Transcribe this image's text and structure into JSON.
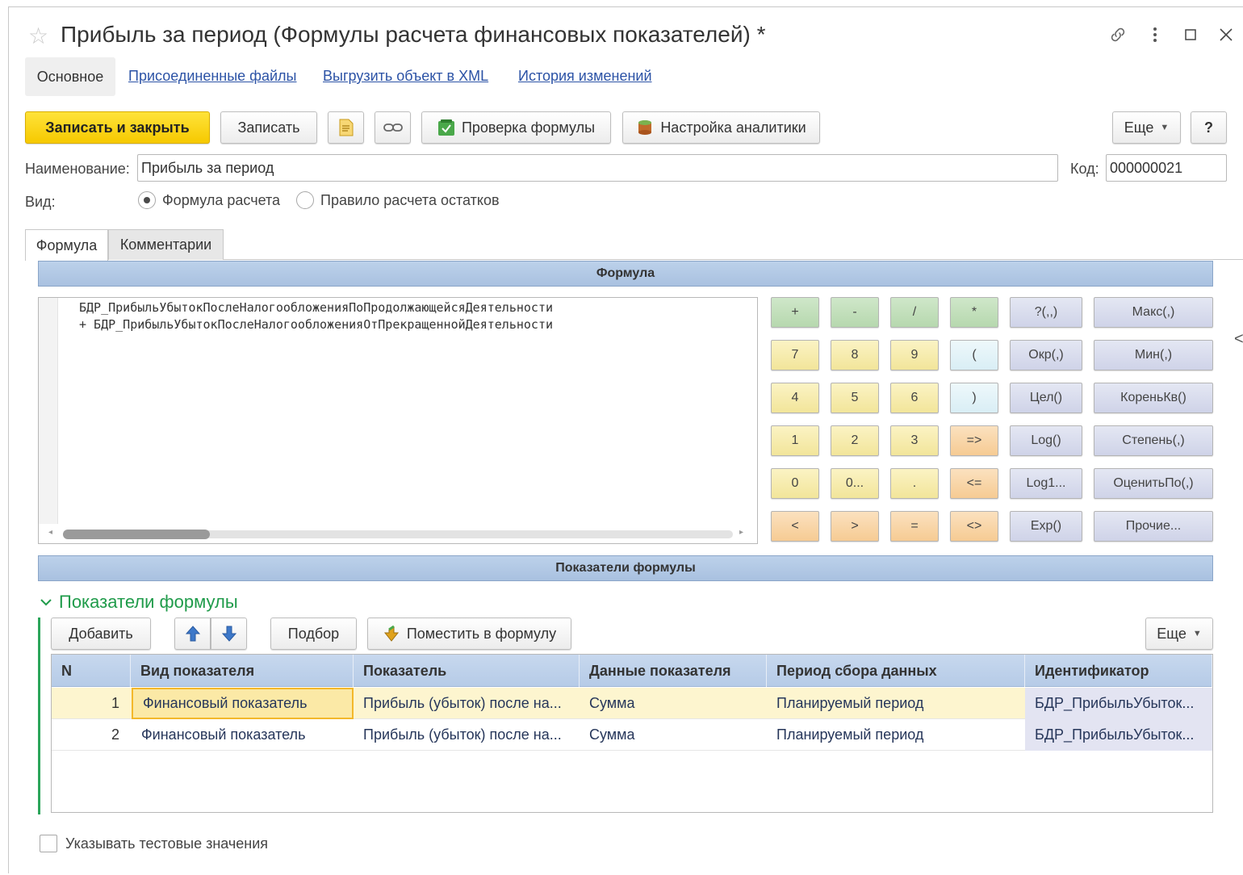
{
  "window": {
    "title": "Прибыль за период (Формулы расчета финансовых показателей) *"
  },
  "nav": {
    "active": "Основное",
    "links": [
      "Присоединенные файлы",
      "Выгрузить объект в XML",
      "История изменений"
    ]
  },
  "toolbar": {
    "save_close": "Записать и закрыть",
    "save": "Записать",
    "check_formula": "Проверка формулы",
    "analytics": "Настройка аналитики",
    "more": "Еще",
    "help": "?"
  },
  "form": {
    "name_label": "Наименование:",
    "name_value": "Прибыль за период",
    "code_label": "Код:",
    "code_value": "000000021",
    "kind_label": "Вид:",
    "kind_options": [
      "Формула расчета",
      "Правило расчета остатков"
    ],
    "kind_selected": "Формула расчета"
  },
  "tabs": [
    "Формула",
    "Комментарии"
  ],
  "formula_section": {
    "header": "Формула",
    "code_lines": [
      "БДР_ПрибыльУбытокПослеНалогообложенияПоПродолжающейсяДеятельности",
      "+ БДР_ПрибыльУбытокПослеНалогообложенияОтПрекращеннойДеятельности"
    ]
  },
  "keypad": [
    [
      "+",
      "-",
      "/",
      "*",
      "?(,,)",
      "Макс(,)"
    ],
    [
      "7",
      "8",
      "9",
      "(",
      "Окр(,)",
      "Мин(,)"
    ],
    [
      "4",
      "5",
      "6",
      ")",
      "Цел()",
      "КореньКв()"
    ],
    [
      "1",
      "2",
      "3",
      "=>",
      "Log()",
      "Степень(,)"
    ],
    [
      "0",
      "0...",
      ".",
      "<=",
      "Log1...",
      "ОценитьПо(,)"
    ],
    [
      "<",
      ">",
      "=",
      "<>",
      "Exp()",
      "Прочие..."
    ]
  ],
  "indicators_section": {
    "header": "Показатели формулы",
    "group_title": "Показатели формулы",
    "add": "Добавить",
    "pick": "Подбор",
    "put_into_formula": "Поместить в формулу",
    "more": "Еще"
  },
  "table": {
    "columns": [
      "N",
      "Вид показателя",
      "Показатель",
      "Данные показателя",
      "Период сбора данных",
      "Идентификатор"
    ],
    "rows": [
      [
        "1",
        "Финансовый показатель",
        "Прибыль (убыток) после на...",
        "Сумма",
        "Планируемый период",
        "БДР_ПрибыльУбыток..."
      ],
      [
        "2",
        "Финансовый показатель",
        "Прибыль (убыток) после на...",
        "Сумма",
        "Планируемый период",
        "БДР_ПрибыльУбыток..."
      ]
    ],
    "selected_row": 1
  },
  "footer": {
    "test_values_label": "Указывать тестовые значения"
  },
  "colors": {
    "primary_button": "#f6c900",
    "link": "#2c53a6",
    "section_header": "#b6cbe7",
    "group_accent": "#1f9b4a",
    "selected_row": "#fdf5cf"
  }
}
